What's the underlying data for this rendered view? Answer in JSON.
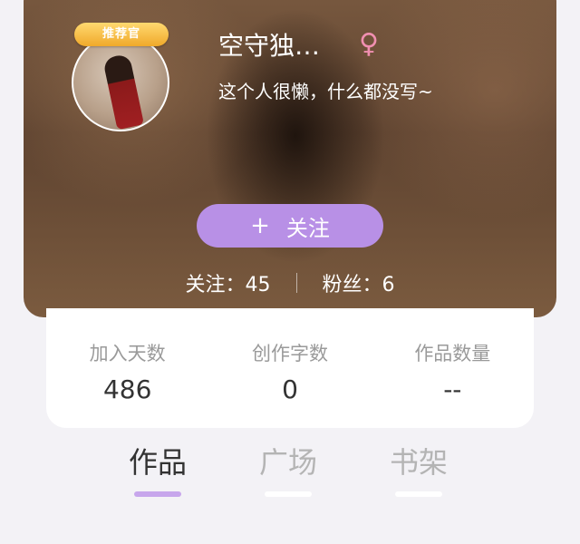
{
  "profile": {
    "badge": "推荐官",
    "username": "空守独…",
    "gender_symbol": "♀",
    "bio": "这个人很懒，什么都没写~",
    "follow_button": {
      "plus": "+",
      "label": "关注"
    },
    "following": "关注：45",
    "fans": "粉丝：6"
  },
  "stats": [
    {
      "label": "加入天数",
      "value": "486"
    },
    {
      "label": "创作字数",
      "value": "0"
    },
    {
      "label": "作品数量",
      "value": "--"
    }
  ],
  "tabs": [
    {
      "label": "作品",
      "active": true
    },
    {
      "label": "广场",
      "active": false
    },
    {
      "label": "书架",
      "active": false
    }
  ],
  "colors": {
    "accent": "#b890e6",
    "tab_indicator": "#c7a6ec",
    "gender": "#f08fb0",
    "badge": "#f0a92a"
  }
}
